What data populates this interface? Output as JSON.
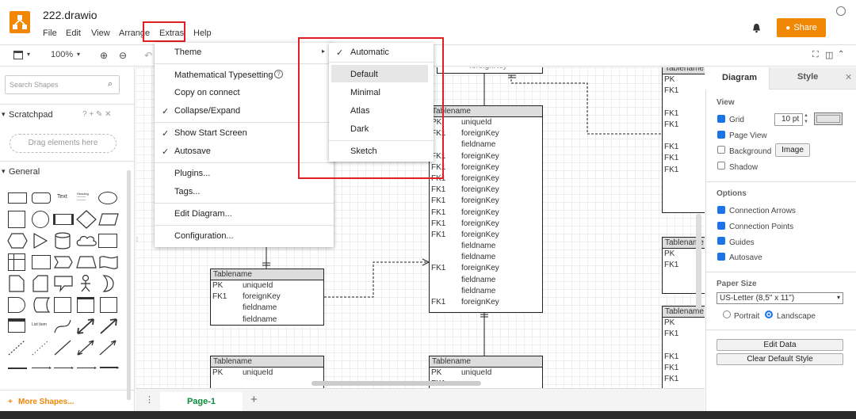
{
  "app": {
    "title": "222.drawio"
  },
  "menubar": [
    "File",
    "Edit",
    "View",
    "Arrange",
    "Extras",
    "Help"
  ],
  "share_label": "Share",
  "toolbar": {
    "zoom": "100%"
  },
  "sidebar": {
    "search_placeholder": "Search Shapes",
    "scratchpad": "Scratchpad",
    "scratch_actions": "? + ✎ ✕",
    "drag_hint": "Drag elements here",
    "general": "General",
    "more_shapes": "More Shapes...",
    "text_shape": "Text",
    "heading_shape": "Heading",
    "list_shape": "List Item"
  },
  "extras_menu": {
    "theme": "Theme",
    "math": "Mathematical Typesetting",
    "copy_connect": "Copy on connect",
    "collapse": "Collapse/Expand",
    "start_screen": "Show Start Screen",
    "autosave": "Autosave",
    "plugins": "Plugins...",
    "tags": "Tags...",
    "edit_diagram": "Edit Diagram...",
    "configuration": "Configuration..."
  },
  "theme_menu": {
    "automatic": "Automatic",
    "default": "Default",
    "minimal": "Minimal",
    "atlas": "Atlas",
    "dark": "Dark",
    "sketch": "Sketch"
  },
  "canvas": {
    "table_name": "Tablename",
    "pk": "PK",
    "fk": "FK1",
    "unique": "uniqueId",
    "foreign": "foreignKey",
    "field": "fieldname",
    "partial_foreign": "foreignKey"
  },
  "page_tab": "Page-1",
  "right_panel": {
    "tab_diagram": "Diagram",
    "tab_style": "Style",
    "view": "View",
    "grid": "Grid",
    "grid_size": "10 pt",
    "page_view": "Page View",
    "background": "Background",
    "image_btn": "Image",
    "shadow": "Shadow",
    "options": "Options",
    "conn_arrows": "Connection Arrows",
    "conn_points": "Connection Points",
    "guides": "Guides",
    "autosave": "Autosave",
    "paper_size": "Paper Size",
    "paper_value": "US-Letter (8,5\" x 11\")",
    "portrait": "Portrait",
    "landscape": "Landscape",
    "edit_data": "Edit Data",
    "clear_style": "Clear Default Style"
  },
  "colors": {
    "accent": "#f08705",
    "highlight_red": "#e02020",
    "checkbox": "#1a73e8",
    "page_tab": "#0a8c3a"
  }
}
